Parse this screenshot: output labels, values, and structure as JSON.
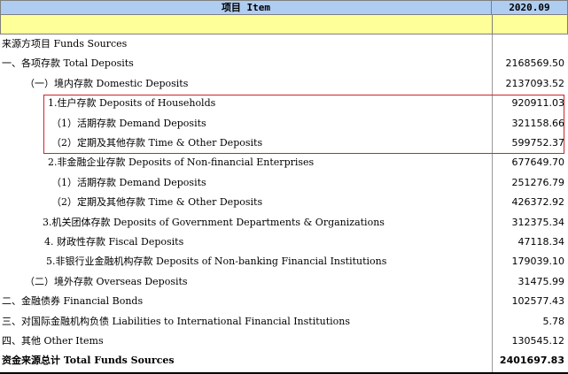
{
  "header": {
    "item_label": "项目 Item",
    "period_label": "2020.09"
  },
  "rows": [
    {
      "label": "来源方项目 Funds Sources",
      "value": ""
    },
    {
      "label": "一、各项存款 Total Deposits",
      "value": "2168569.50"
    },
    {
      "label": "（一）境内存款 Domestic Deposits",
      "value": "2137093.52"
    },
    {
      "label": "1.住户存款 Deposits of Households",
      "value": "920911.03"
    },
    {
      "label": "（1）活期存款 Demand  Deposits",
      "value": "321158.66"
    },
    {
      "label": "（2）定期及其他存款 Time & Other Deposits",
      "value": "599752.37"
    },
    {
      "label": "2.非金融企业存款 Deposits of Non-financial Enterprises",
      "value": "677649.70"
    },
    {
      "label": "（1）活期存款 Demand  Deposits",
      "value": "251276.79"
    },
    {
      "label": "（2）定期及其他存款 Time & Other Deposits",
      "value": "426372.92"
    },
    {
      "label": "3.机关团体存款  Deposits of Government Departments & Organizations",
      "value": "312375.34"
    },
    {
      "label": "4. 财政性存款 Fiscal Deposits",
      "value": "47118.34"
    },
    {
      "label": "5.非银行业金融机构存款 Deposits of Non-banking Financial Institutions",
      "value": "179039.10"
    },
    {
      "label": "（二）境外存款 Overseas Deposits",
      "value": "31475.99"
    },
    {
      "label": "二、金融债券 Financial Bonds",
      "value": "102577.43"
    },
    {
      "label": "三、对国际金融机构负债 Liabilities to International Financial Institutions",
      "value": "5.78"
    },
    {
      "label": "四、其他 Other Items",
      "value": "130545.12"
    },
    {
      "label": "资金来源总计 Total Funds Sources",
      "value": "2401697.83"
    }
  ],
  "highlight_color": "#d2232a",
  "header_color": "#aecdf0",
  "subheader_color": "#ffff99"
}
